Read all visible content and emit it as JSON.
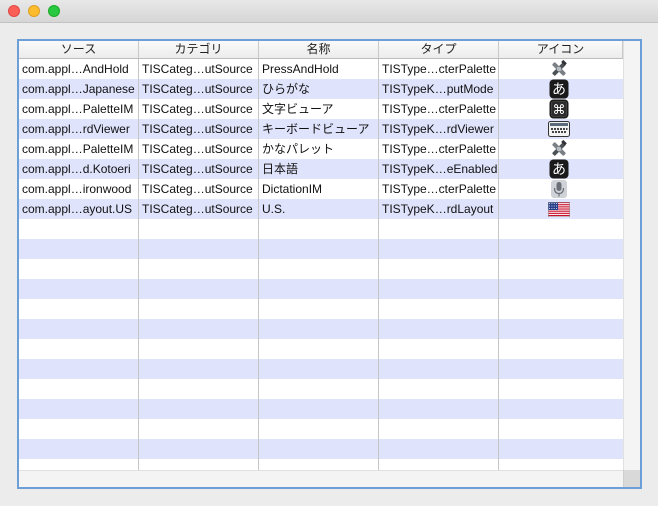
{
  "table": {
    "columns": [
      "ソース",
      "カテゴリ",
      "名称",
      "タイプ",
      "アイコン"
    ],
    "rows": [
      {
        "source": "com.appl…AndHold",
        "category": "TISCateg…utSource",
        "name": "PressAndHold",
        "type": "TISType…cterPalette",
        "icon": "tools-icon"
      },
      {
        "source": "com.appl…Japanese",
        "category": "TISCateg…utSource",
        "name": "ひらがな",
        "type": "TISTypeK…putMode",
        "icon": "hiragana-a-icon"
      },
      {
        "source": "com.appl…PaletteIM",
        "category": "TISCateg…utSource",
        "name": "文字ビューア",
        "type": "TISType…cterPalette",
        "icon": "command-key-icon"
      },
      {
        "source": "com.appl…rdViewer",
        "category": "TISCateg…utSource",
        "name": "キーボードビューア",
        "type": "TISTypeK…rdViewer",
        "icon": "keyboard-icon"
      },
      {
        "source": "com.appl…PaletteIM",
        "category": "TISCateg…utSource",
        "name": "かなパレット",
        "type": "TISType…cterPalette",
        "icon": "tools-icon"
      },
      {
        "source": "com.appl…d.Kotoeri",
        "category": "TISCateg…utSource",
        "name": "日本語",
        "type": "TISTypeK…eEnabled",
        "icon": "hiragana-a-icon"
      },
      {
        "source": "com.appl…ironwood",
        "category": "TISCateg…utSource",
        "name": "DictationIM",
        "type": "TISType…cterPalette",
        "icon": "microphone-icon"
      },
      {
        "source": "com.appl…ayout.US",
        "category": "TISCateg…utSource",
        "name": "U.S.",
        "type": "TISTypeK…rdLayout",
        "icon": "us-flag-icon"
      }
    ],
    "empty_row_count": 13
  },
  "colors": {
    "stripe": "#dfe3fb",
    "focus_ring": "#6a9fd8",
    "gridline": "#c6c6c6"
  }
}
